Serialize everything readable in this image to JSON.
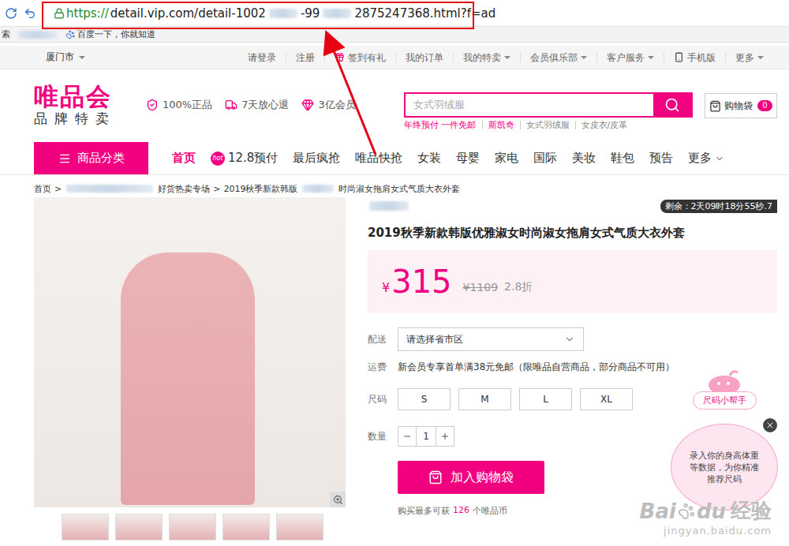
{
  "browser": {
    "url": [
      {
        "kind": "secure",
        "text": "https://"
      },
      {
        "kind": "text",
        "text": "detail.vip.com/detail-1002"
      },
      {
        "kind": "blur"
      },
      {
        "kind": "text",
        "text": "-99"
      },
      {
        "kind": "blur"
      },
      {
        "kind": "text",
        "text": "2875247368.html?f=ad"
      }
    ],
    "bookmarks": [
      {
        "kind": "text",
        "text": "索"
      },
      {
        "kind": "blur"
      },
      {
        "kind": "baidu",
        "text": "百度一下，你就知道"
      }
    ]
  },
  "top_bar": {
    "city": "厦门市",
    "city_dropdown": true,
    "links": [
      {
        "label": "请登录",
        "dropdown": false,
        "kind": "plain"
      },
      {
        "label": "注册",
        "dropdown": false,
        "kind": "plain"
      },
      {
        "label": "签到有礼",
        "dropdown": false,
        "kind": "gift"
      },
      {
        "label": "我的订单",
        "dropdown": false,
        "kind": "plain"
      },
      {
        "label": "我的特卖",
        "dropdown": true,
        "kind": "plain"
      },
      {
        "label": "会员俱乐部",
        "dropdown": true,
        "kind": "plain"
      },
      {
        "label": "客户服务",
        "dropdown": true,
        "kind": "plain"
      },
      {
        "label": "手机版",
        "dropdown": false,
        "kind": "mobile"
      },
      {
        "label": "更多",
        "dropdown": true,
        "kind": "plain"
      }
    ]
  },
  "header": {
    "logo": {
      "name": "唯品会",
      "tagline": "品牌特卖"
    },
    "badges": [
      "100%正品",
      "7天放心退",
      "3亿会员"
    ],
    "search": {
      "placeholder": "女式羽绒服",
      "hot": [
        {
          "label": "年终预付 一件免邮",
          "highlighted": true
        },
        {
          "label": "斯凯奇",
          "highlighted": true
        },
        {
          "label": "女式羽绒服",
          "highlighted": false
        },
        {
          "label": "女皮衣/皮革",
          "highlighted": false
        }
      ]
    },
    "cart": {
      "label": "购物袋",
      "count": "0"
    }
  },
  "nav": {
    "category": "商品分类",
    "items": [
      {
        "label": "首页",
        "selected": true,
        "badge": "",
        "dropdown": false
      },
      {
        "label": "12.8预付",
        "selected": false,
        "badge": "hot",
        "dropdown": false
      },
      {
        "label": "最后疯抢",
        "selected": false,
        "badge": "",
        "dropdown": false
      },
      {
        "label": "唯品快抢",
        "selected": false,
        "badge": "",
        "dropdown": false
      },
      {
        "label": "女装",
        "selected": false,
        "badge": "",
        "dropdown": false
      },
      {
        "label": "母婴",
        "selected": false,
        "badge": "",
        "dropdown": false
      },
      {
        "label": "家电",
        "selected": false,
        "badge": "",
        "dropdown": false
      },
      {
        "label": "国际",
        "selected": false,
        "badge": "",
        "dropdown": false
      },
      {
        "label": "美妆",
        "selected": false,
        "badge": "",
        "dropdown": false
      },
      {
        "label": "鞋包",
        "selected": false,
        "badge": "",
        "dropdown": false
      },
      {
        "label": "预告",
        "selected": false,
        "badge": "",
        "dropdown": false
      },
      {
        "label": "更多",
        "selected": false,
        "badge": "",
        "dropdown": true
      }
    ]
  },
  "breadcrumb": [
    {
      "kind": "link",
      "text": "首页"
    },
    {
      "kind": "sep",
      "text": ">"
    },
    {
      "kind": "blur"
    },
    {
      "kind": "link",
      "text": "好货热卖专场"
    },
    {
      "kind": "sep",
      "text": ">"
    },
    {
      "kind": "link",
      "text": "2019秋季新款韩版"
    },
    {
      "kind": "blur"
    },
    {
      "kind": "link",
      "text": "时尚淑女拖肩女式气质大衣外套"
    }
  ],
  "gallery": {
    "thumbnails": [
      {
        "selected": false
      },
      {
        "selected": false
      },
      {
        "selected": false
      },
      {
        "selected": false
      },
      {
        "selected": false
      }
    ]
  },
  "product": {
    "timer": "剩余：2天09时18分55秒.7",
    "title": "2019秋季新款韩版优雅淑女时尚淑女拖肩女式气质大衣外套",
    "price": {
      "currency": "¥",
      "value": "315",
      "original": "¥1109",
      "discount": "2.8折"
    },
    "delivery": {
      "label": "配送",
      "placeholder": "请选择省市区"
    },
    "shipping": {
      "label": "运费",
      "text": "新会员专享首单满38元免邮（限唯品自营商品，部分商品不可用）"
    },
    "sizes": {
      "label": "尺码",
      "options": [
        {
          "label": "S",
          "selected": false
        },
        {
          "label": "M",
          "selected": false
        },
        {
          "label": "L",
          "selected": false
        },
        {
          "label": "XL",
          "selected": false
        }
      ]
    },
    "quantity": {
      "label": "数量",
      "value": "1"
    },
    "add_button": "加入购物袋",
    "coins": {
      "prefix": "购买最多可获",
      "amount": "126",
      "suffix": "个唯品币"
    }
  },
  "size_helper": {
    "label": "尺码小帮手",
    "message": "录入你的身高体重等数据，为你精准推荐尺码"
  },
  "watermark": {
    "parts": [
      "Bai",
      "du",
      "经验"
    ],
    "site": "jingyan.baidu.com"
  }
}
